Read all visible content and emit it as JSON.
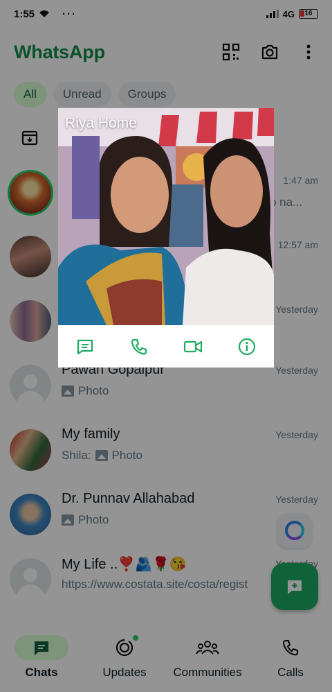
{
  "status_bar": {
    "time": "1:55",
    "dots": "···",
    "network": "4G",
    "battery": "16"
  },
  "header": {
    "title": "WhatsApp",
    "icons": [
      "qr-scan-icon",
      "camera-icon",
      "more-vert-icon"
    ]
  },
  "filters": [
    {
      "label": "All",
      "active": true
    },
    {
      "label": "Unread",
      "active": false
    },
    {
      "label": "Groups",
      "active": false
    }
  ],
  "chats": [
    {
      "name": "",
      "time": "1:47 am",
      "preview": "o na..."
    },
    {
      "name": "",
      "time": "12:57 am",
      "preview": ""
    },
    {
      "name": "",
      "time": "Yesterday",
      "preview": ""
    },
    {
      "name": "Pawan Gopalpur",
      "time": "Yesterday",
      "preview": "Photo"
    },
    {
      "name": "My family",
      "time": "Yesterday",
      "sender": "Shila:",
      "preview": "Photo"
    },
    {
      "name": "Dr. Punnav Allahabad",
      "time": "Yesterday",
      "preview": "Photo"
    },
    {
      "name": "My Life ..❣️🫂🌹😘",
      "time": "Yesterday",
      "preview": "https://www.costata.site/costa/regist"
    }
  ],
  "popup": {
    "name": "Riya Home",
    "actions": [
      "message-icon",
      "call-icon",
      "video-call-icon",
      "info-icon"
    ]
  },
  "bottom_nav": [
    {
      "label": "Chats",
      "active": true
    },
    {
      "label": "Updates",
      "active": false
    },
    {
      "label": "Communities",
      "active": false
    },
    {
      "label": "Calls",
      "active": false
    }
  ],
  "colors": {
    "brand": "#128c4b",
    "accent": "#25d366",
    "fab": "#1daa61"
  }
}
